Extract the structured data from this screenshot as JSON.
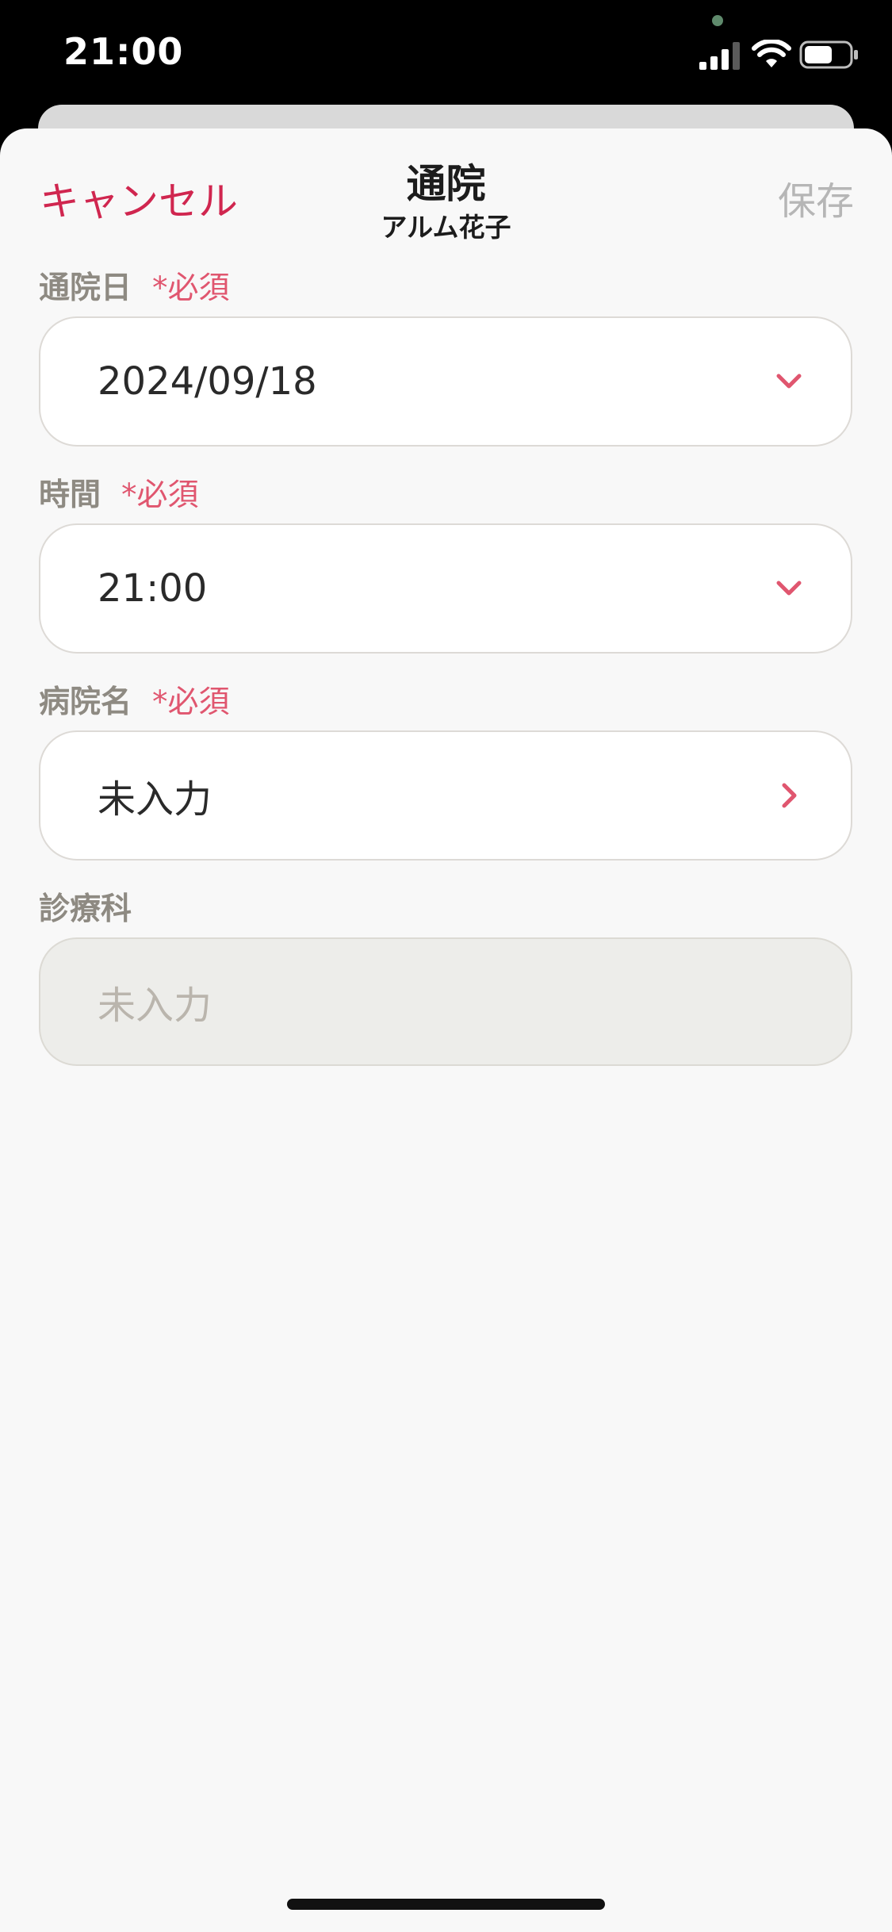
{
  "status_bar": {
    "time": "21:00",
    "icons": [
      "signal-icon",
      "wifi-icon",
      "battery-icon"
    ]
  },
  "nav": {
    "cancel_label": "キャンセル",
    "title": "通院",
    "subtitle": "アルム花子",
    "save_label": "保存"
  },
  "form": {
    "required_text": "*必須",
    "visit_date": {
      "label": "通院日",
      "required": true,
      "value": "2024/09/18",
      "icon": "chevron-down-icon"
    },
    "visit_time": {
      "label": "時間",
      "required": true,
      "value": "21:00",
      "icon": "chevron-down-icon"
    },
    "hospital_name": {
      "label": "病院名",
      "required": true,
      "value": "未入力",
      "icon": "chevron-right-icon"
    },
    "department": {
      "label": "診療科",
      "required": false,
      "placeholder": "未入力",
      "disabled": true
    }
  },
  "colors": {
    "accent": "#d0264f",
    "required": "#e0566f",
    "label": "#8e8a82",
    "disabled_text": "#b6b6b6",
    "sheet_background": "#f8f8f8",
    "field_background": "#ffffff",
    "disabled_field_background": "#ededea"
  }
}
